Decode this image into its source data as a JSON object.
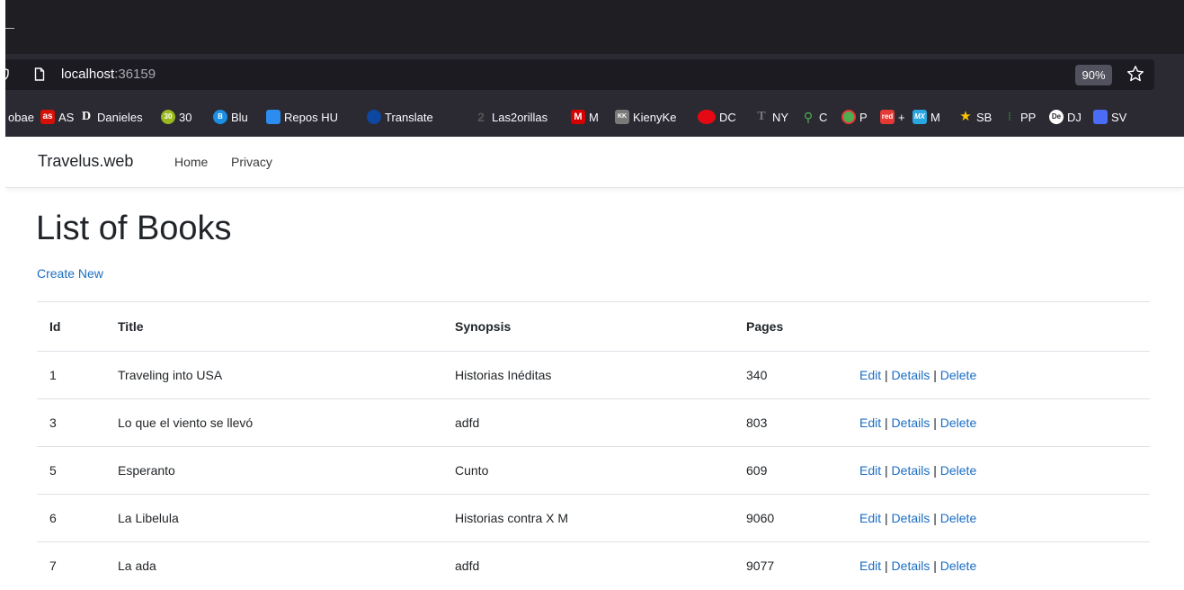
{
  "browser": {
    "url_host": "localhost",
    "url_port": ":36159",
    "zoom": "90%",
    "bookmarks": [
      {
        "label": "obae",
        "icon": "none",
        "color": ""
      },
      {
        "label": "AS",
        "icon": "as-icon",
        "badge": "as",
        "color": "#d51007"
      },
      {
        "label": "Danieles",
        "icon": "d-letter-icon",
        "badge": "D",
        "color": "#2b2a33"
      },
      {
        "label": "30",
        "icon": "30-badge-icon",
        "badge": "30",
        "color": "#9bb81e"
      },
      {
        "label": "Blu",
        "icon": "blu-icon",
        "badge": "B",
        "color": "#1a8fe3"
      },
      {
        "label": "Repos HU",
        "icon": "azure-devops-icon",
        "badge": "",
        "color": "#2d8cf0"
      },
      {
        "label": "Translate",
        "icon": "translate-icon",
        "badge": "",
        "color": "#0d47a1"
      },
      {
        "label": "Las2orillas",
        "icon": "las2orillas-icon",
        "badge": "2",
        "color": "#3a3a3a"
      },
      {
        "label": "M",
        "icon": "m-red-icon",
        "badge": "M",
        "color": "#d50000"
      },
      {
        "label": "KienyKe",
        "icon": "kienyke-icon",
        "badge": "KK",
        "color": "#7a7a7a"
      },
      {
        "label": "DC",
        "icon": "dc-icon",
        "badge": "",
        "color": "#e50914"
      },
      {
        "label": "NY",
        "icon": "nyt-icon",
        "badge": "T",
        "color": "#3a3a3a"
      },
      {
        "label": "C",
        "icon": "c-pin-icon",
        "badge": "",
        "color": "#4caf50"
      },
      {
        "label": "P",
        "icon": "p-circle-icon",
        "badge": "",
        "color": "#4caf50"
      },
      {
        "label": "+",
        "icon": "red-icon",
        "badge": "red",
        "color": "#e53935"
      },
      {
        "label": "M",
        "icon": "mx-icon",
        "badge": "MX",
        "color": "#2aa7e0"
      },
      {
        "label": "SB",
        "icon": "star-sb-icon",
        "badge": "",
        "color": "#f9c400"
      },
      {
        "label": "PP",
        "icon": "pp-icon",
        "badge": "",
        "color": "#2e7d32"
      },
      {
        "label": "DJ",
        "icon": "dj-icon",
        "badge": "De",
        "color": "#ffffff"
      },
      {
        "label": "SV",
        "icon": "sv-icon",
        "badge": "",
        "color": "#4a6cf7"
      }
    ]
  },
  "nav": {
    "brand": "Travelus.web",
    "links": [
      "Home",
      "Privacy"
    ]
  },
  "page": {
    "title": "List of Books",
    "create_label": "Create New"
  },
  "table": {
    "headers": [
      "Id",
      "Title",
      "Synopsis",
      "Pages",
      ""
    ],
    "rows": [
      {
        "id": "1",
        "title": "Traveling into USA",
        "synopsis": "Historias Inéditas",
        "pages": "340"
      },
      {
        "id": "3",
        "title": "Lo que el viento se llevó",
        "synopsis": "adfd",
        "pages": "803"
      },
      {
        "id": "5",
        "title": "Esperanto",
        "synopsis": "Cunto",
        "pages": "609"
      },
      {
        "id": "6",
        "title": "La Libelula",
        "synopsis": "Historias contra X M",
        "pages": "9060"
      },
      {
        "id": "7",
        "title": "La ada",
        "synopsis": "adfd",
        "pages": "9077"
      }
    ],
    "actions": {
      "edit": "Edit",
      "details": "Details",
      "delete": "Delete",
      "separator": "|"
    }
  },
  "colors": {
    "link": "#1b6ec2",
    "chrome_dark": "#1f1f23",
    "toolbar": "#2b2a33"
  }
}
